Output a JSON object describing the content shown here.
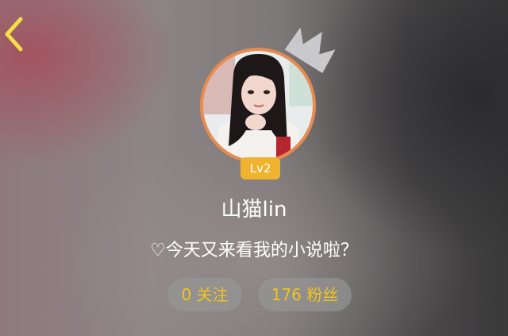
{
  "profile": {
    "username": "山猫lin",
    "level": "Lv2",
    "bio": "♡今天又来看我的小说啦？",
    "following_label": "0 关注",
    "followers_label": "176 粉丝"
  },
  "icons": {
    "back": "chevron-left-icon",
    "crown": "crown-icon"
  },
  "colors": {
    "back_icon": "#f5e04a",
    "avatar_ring": "#e98a4e",
    "level_badge": "#f0b32f",
    "stat_text": "#f2c41c"
  }
}
